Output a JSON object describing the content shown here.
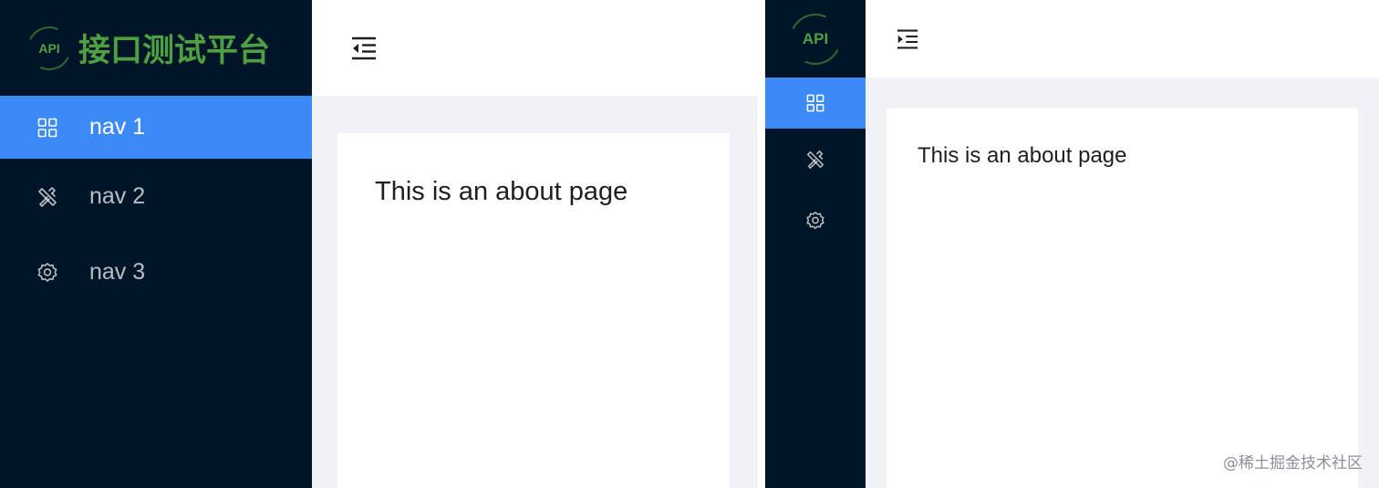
{
  "left_panel": {
    "logo": {
      "badge": "API",
      "title": "接口测试平台"
    },
    "trigger_icon": "menu-fold-icon",
    "menu": [
      {
        "label": "nav 1",
        "icon": "appstore-icon",
        "active": true
      },
      {
        "label": "nav 2",
        "icon": "tools-icon",
        "active": false
      },
      {
        "label": "nav 3",
        "icon": "setting-icon",
        "active": false
      }
    ],
    "content": {
      "text": "This is an about page"
    }
  },
  "right_panel": {
    "logo": {
      "badge": "API"
    },
    "trigger_icon": "menu-unfold-icon",
    "menu": [
      {
        "icon": "appstore-icon",
        "active": true
      },
      {
        "icon": "tools-icon",
        "active": false
      },
      {
        "icon": "setting-icon",
        "active": false
      }
    ],
    "content": {
      "text": "This is an about page"
    }
  },
  "watermark": "@稀土掘金技术社区",
  "colors": {
    "sider_bg": "#011528",
    "active_item": "#3c8af7",
    "logo_green": "#4ea043",
    "content_bg": "#f0f2f5"
  }
}
